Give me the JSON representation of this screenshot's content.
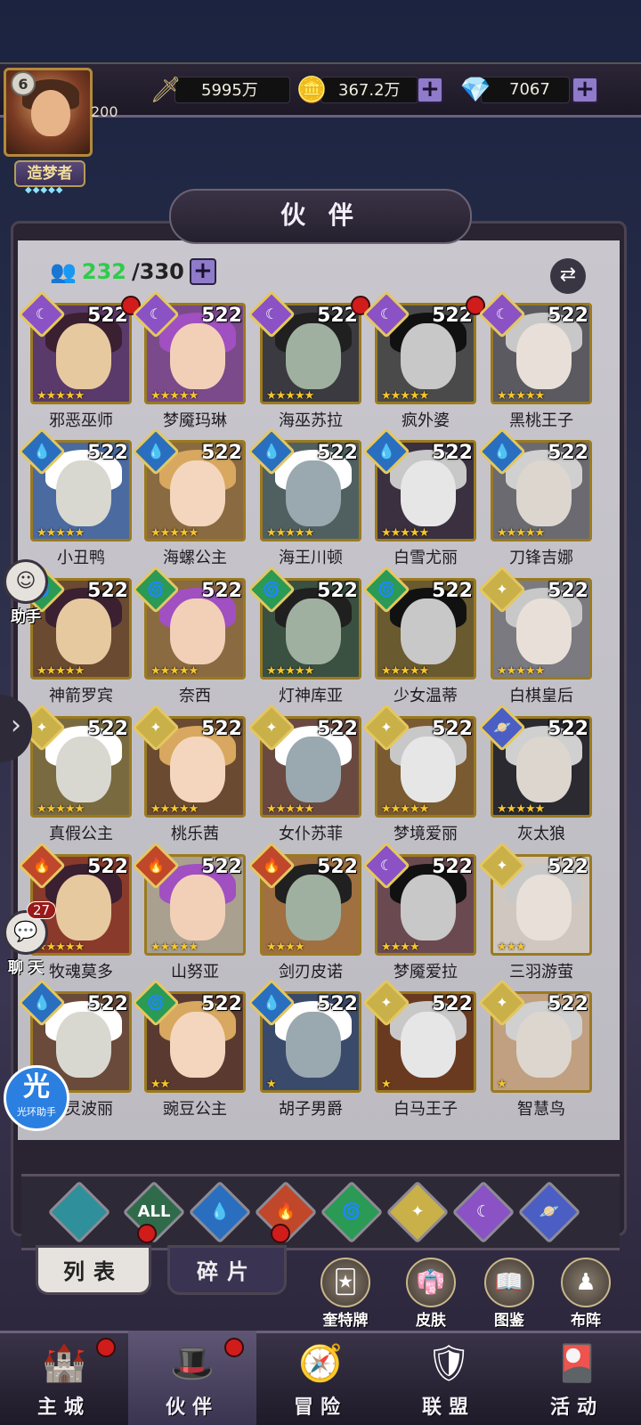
{
  "player": {
    "level": "6",
    "exp": "200",
    "title": "造梦者"
  },
  "resources": {
    "power": "5995万",
    "gold": "367.2万",
    "diamond": "7067"
  },
  "panel": {
    "title": "伙 伴",
    "count_current": "232",
    "count_total": "/330"
  },
  "companions": [
    {
      "name": "邪恶巫师",
      "level": "522",
      "element": "moon",
      "stars": 5,
      "red_dot": true
    },
    {
      "name": "梦魇玛琳",
      "level": "522",
      "element": "moon",
      "stars": 5,
      "red_dot": false
    },
    {
      "name": "海巫苏拉",
      "level": "522",
      "element": "moon",
      "stars": 5,
      "red_dot": true
    },
    {
      "name": "疯外婆",
      "level": "522",
      "element": "moon",
      "stars": 5,
      "red_dot": true
    },
    {
      "name": "黑桃王子",
      "level": "522",
      "element": "moon",
      "stars": 5,
      "red_dot": false
    },
    {
      "name": "小丑鸭",
      "level": "522",
      "element": "water",
      "stars": 5,
      "red_dot": false
    },
    {
      "name": "海螺公主",
      "level": "522",
      "element": "water",
      "stars": 5,
      "red_dot": false
    },
    {
      "name": "海王川顿",
      "level": "522",
      "element": "water",
      "stars": 5,
      "red_dot": false
    },
    {
      "name": "白雪尤丽",
      "level": "522",
      "element": "water",
      "stars": 5,
      "red_dot": false
    },
    {
      "name": "刀锋吉娜",
      "level": "522",
      "element": "water",
      "stars": 5,
      "red_dot": false
    },
    {
      "name": "神箭罗宾",
      "level": "522",
      "element": "wind",
      "stars": 5,
      "red_dot": false
    },
    {
      "name": "奈西",
      "level": "522",
      "element": "wind",
      "stars": 5,
      "red_dot": false
    },
    {
      "name": "灯神库亚",
      "level": "522",
      "element": "wind",
      "stars": 5,
      "red_dot": false
    },
    {
      "name": "少女温蒂",
      "level": "522",
      "element": "wind",
      "stars": 5,
      "red_dot": false
    },
    {
      "name": "白棋皇后",
      "level": "522",
      "element": "light",
      "stars": 5,
      "red_dot": false
    },
    {
      "name": "真假公主",
      "level": "522",
      "element": "light",
      "stars": 5,
      "red_dot": false
    },
    {
      "name": "桃乐茜",
      "level": "522",
      "element": "light",
      "stars": 5,
      "red_dot": false
    },
    {
      "name": "女仆苏菲",
      "level": "522",
      "element": "light",
      "stars": 5,
      "red_dot": false
    },
    {
      "name": "梦境爱丽",
      "level": "522",
      "element": "light",
      "stars": 5,
      "red_dot": false
    },
    {
      "name": "灰太狼",
      "level": "522",
      "element": "planet",
      "stars": 5,
      "red_dot": false
    },
    {
      "name": "牧魂莫多",
      "level": "522",
      "element": "fire",
      "stars": 5,
      "red_dot": false
    },
    {
      "name": "山努亚",
      "level": "522",
      "element": "fire",
      "stars": 5,
      "red_dot": false
    },
    {
      "name": "剑刃皮诺",
      "level": "522",
      "element": "fire",
      "stars": 4,
      "red_dot": false
    },
    {
      "name": "梦魇爱拉",
      "level": "522",
      "element": "moon",
      "stars": 4,
      "red_dot": false
    },
    {
      "name": "三羽游萤",
      "level": "522",
      "element": "light",
      "stars": 3,
      "red_dot": false
    },
    {
      "name": "幽灵波丽",
      "level": "522",
      "element": "water",
      "stars": 2,
      "red_dot": false
    },
    {
      "name": "豌豆公主",
      "level": "522",
      "element": "wind",
      "stars": 2,
      "red_dot": false
    },
    {
      "name": "胡子男爵",
      "level": "522",
      "element": "water",
      "stars": 1,
      "red_dot": false
    },
    {
      "name": "白马王子",
      "level": "522",
      "element": "light",
      "stars": 1,
      "red_dot": false
    },
    {
      "name": "智慧鸟",
      "level": "522",
      "element": "light",
      "stars": 1,
      "red_dot": false
    }
  ],
  "filters": [
    {
      "id": "shield",
      "label": "",
      "color": "#2f8f9a"
    },
    {
      "id": "all",
      "label": "ALL",
      "color": "#2f6b4a"
    },
    {
      "id": "water",
      "label": "💧",
      "color": "#2a6fbf"
    },
    {
      "id": "fire",
      "label": "🔥",
      "color": "#c0472a"
    },
    {
      "id": "wind",
      "label": "🌀",
      "color": "#2a9a55"
    },
    {
      "id": "light",
      "label": "✦",
      "color": "#c9b048"
    },
    {
      "id": "moon",
      "label": "☾",
      "color": "#8a52c4"
    },
    {
      "id": "planet",
      "label": "🪐",
      "color": "#4a5ec4"
    }
  ],
  "tabs": {
    "list": "列表",
    "shards": "碎片"
  },
  "tools": [
    {
      "label": "奎特牌",
      "icon": "🃏"
    },
    {
      "label": "皮肤",
      "icon": "👘"
    },
    {
      "label": "图鉴",
      "icon": "📖"
    },
    {
      "label": "布阵",
      "icon": "♟"
    }
  ],
  "side": {
    "assistant": "助手",
    "chat": "聊 天",
    "chat_count": "27",
    "guang_big": "光",
    "guang_small": "光环助手"
  },
  "nav": [
    {
      "label": "主城",
      "icon": "🏰",
      "active": false,
      "dot": true
    },
    {
      "label": "伙伴",
      "icon": "🎩",
      "active": true,
      "dot": true
    },
    {
      "label": "冒险",
      "icon": "🧭",
      "active": false,
      "dot": false
    },
    {
      "label": "联盟",
      "icon": "🛡",
      "active": false,
      "dot": false
    },
    {
      "label": "活动",
      "icon": "🎴",
      "active": false,
      "dot": false
    }
  ],
  "colors": {
    "frame_gold": "#9b7a1f",
    "count_green": "#2ecc4a",
    "red_dot": "#d11c1c",
    "element_moon": "#8a52c4",
    "element_water": "#2a6fbf",
    "element_wind": "#2a9a55",
    "element_light": "#c9b048",
    "element_fire": "#c0472a",
    "element_planet": "#4a5ec4"
  }
}
